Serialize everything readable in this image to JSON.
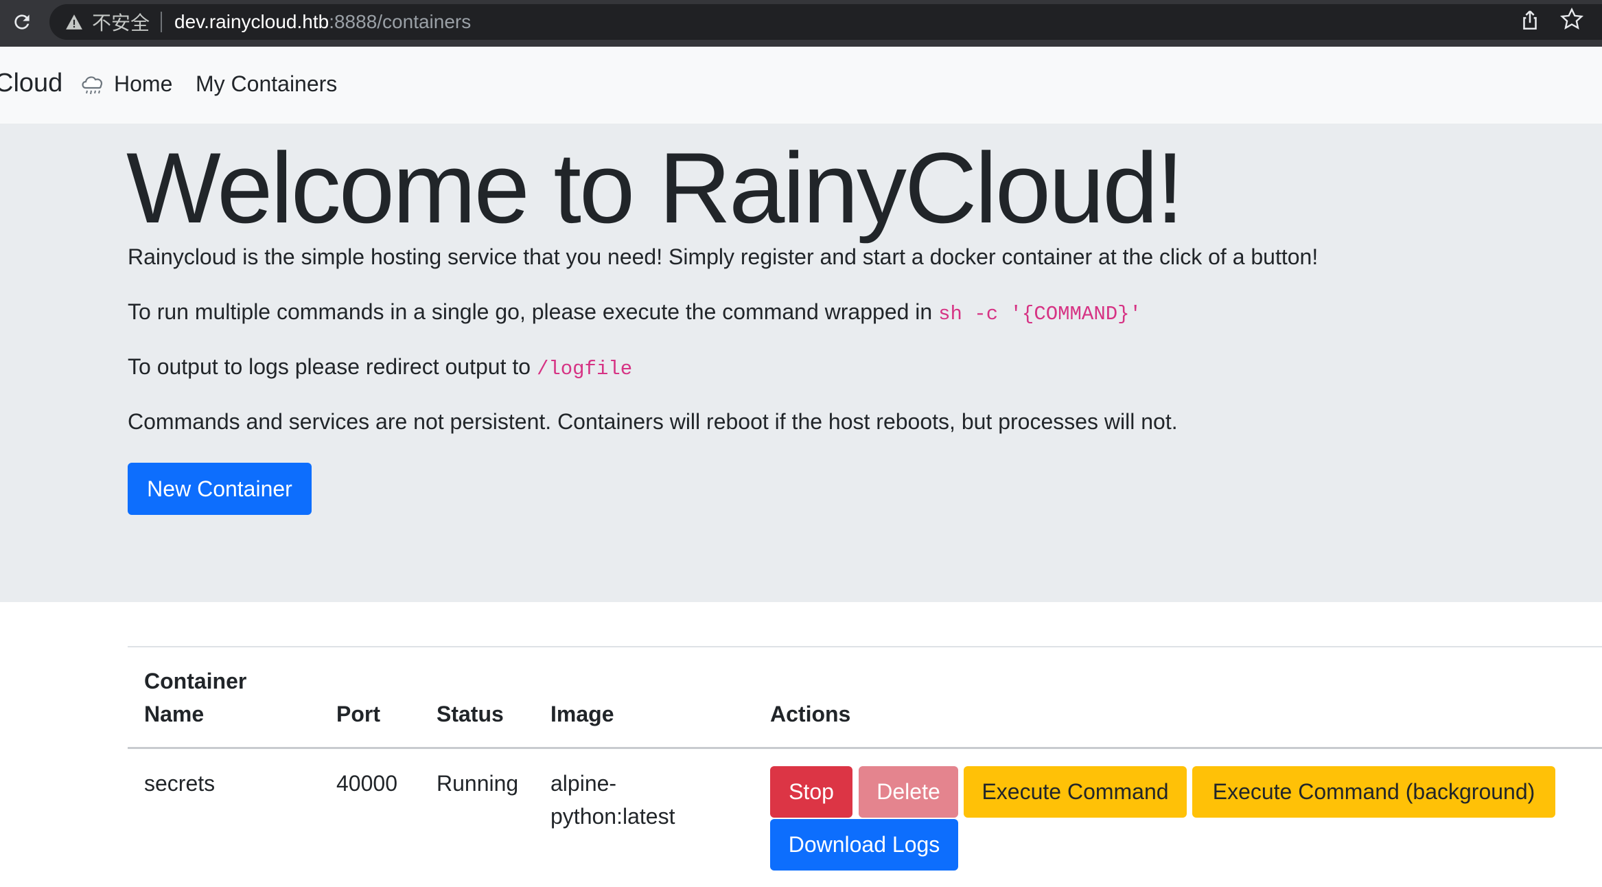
{
  "browser": {
    "security_label": "不安全",
    "url_host": "dev.rainycloud.htb",
    "url_rest": ":8888/containers"
  },
  "navbar": {
    "brand": "Cloud",
    "home": "Home",
    "my_containers": "My Containers"
  },
  "hero": {
    "title": "Welcome to RainyCloud!",
    "p1": "Rainycloud is the simple hosting service that you need! Simply register and start a docker container at the click of a button!",
    "p2_text": "To run multiple commands in a single go, please execute the command wrapped in ",
    "p2_code": "sh -c '{COMMAND}'",
    "p3_text": "To output to logs please redirect output to ",
    "p3_code": "/logfile",
    "p4": "Commands and services are not persistent. Containers will reboot if the host reboots, but processes will not.",
    "new_container_button": "New Container"
  },
  "table": {
    "headers": {
      "name_line1": "Container",
      "name_line2": "Name",
      "port": "Port",
      "status": "Status",
      "image": "Image",
      "actions": "Actions"
    },
    "rows": [
      {
        "name": "secrets",
        "port": "40000",
        "status": "Running",
        "image_line1": "alpine-",
        "image_line2": "python:latest",
        "actions": {
          "stop": "Stop",
          "delete": "Delete",
          "execute": "Execute Command",
          "execute_bg": "Execute Command (background)",
          "download_logs": "Download Logs"
        }
      }
    ]
  },
  "colors": {
    "primary": "#0d6efd",
    "danger": "#dc3545",
    "danger_disabled": "#e4848e",
    "warning": "#ffc107",
    "code": "#d63384"
  }
}
